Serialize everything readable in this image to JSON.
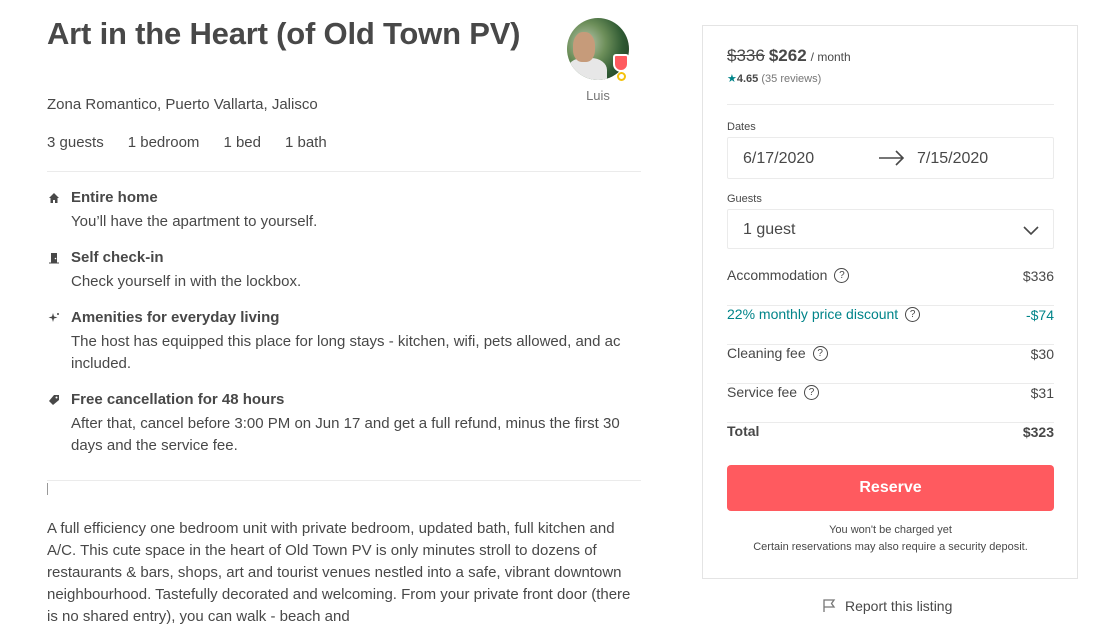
{
  "listing": {
    "title": "Art in the Heart (of Old Town PV)",
    "location": "Zona Romantico, Puerto Vallarta, Jalisco",
    "facts": [
      "3 guests",
      "1 bedroom",
      "1 bed",
      "1 bath"
    ],
    "host_name": "Luis"
  },
  "highlights": [
    {
      "icon": "house-icon",
      "title": "Entire home",
      "desc": "You’ll have the apartment to yourself."
    },
    {
      "icon": "door-icon",
      "title": "Self check-in",
      "desc": "Check yourself in with the lockbox."
    },
    {
      "icon": "sparkle-icon",
      "title": "Amenities for everyday living",
      "desc": "The host has equipped this place for long stays - kitchen, wifi, pets allowed, and ac included."
    },
    {
      "icon": "tag-icon",
      "title": "Free cancellation for 48 hours",
      "desc": "After that, cancel before 3:00 PM on Jun 17 and get a full refund, minus the first 30 days and the service fee."
    }
  ],
  "description": "A full efficiency one bedroom unit with private bedroom, updated bath, full kitchen and A/C. This cute space in the heart of Old Town PV is only minutes stroll to dozens of restaurants & bars, shops, art and tourist venues nestled into a safe, vibrant downtown neighbourhood. Tastefully decorated and welcoming. From your private front door (there is no shared entry), you can walk - beach and",
  "booking": {
    "old_price": "$336",
    "new_price": "$262",
    "per": "/ month",
    "rating": "4.65",
    "reviews": "(35 reviews)",
    "dates_label": "Dates",
    "check_in": "6/17/2020",
    "check_out": "7/15/2020",
    "guests_label": "Guests",
    "guests_value": "1 guest",
    "fees": [
      {
        "label": "Accommodation",
        "value": "$336",
        "help": true
      },
      {
        "label": "22% monthly price discount",
        "value": "-$74",
        "help": true
      },
      {
        "label": "Cleaning fee",
        "value": "$30",
        "help": true
      },
      {
        "label": "Service fee",
        "value": "$31",
        "help": true
      },
      {
        "label": "Total",
        "value": "$323",
        "help": false
      }
    ],
    "reserve_label": "Reserve",
    "note_1": "You won't be charged yet",
    "note_2": "Certain reservations may also require a security deposit."
  },
  "report_label": "Report this listing",
  "colors": {
    "brand": "#ff5a5f",
    "teal": "#008489",
    "text": "#484848"
  }
}
